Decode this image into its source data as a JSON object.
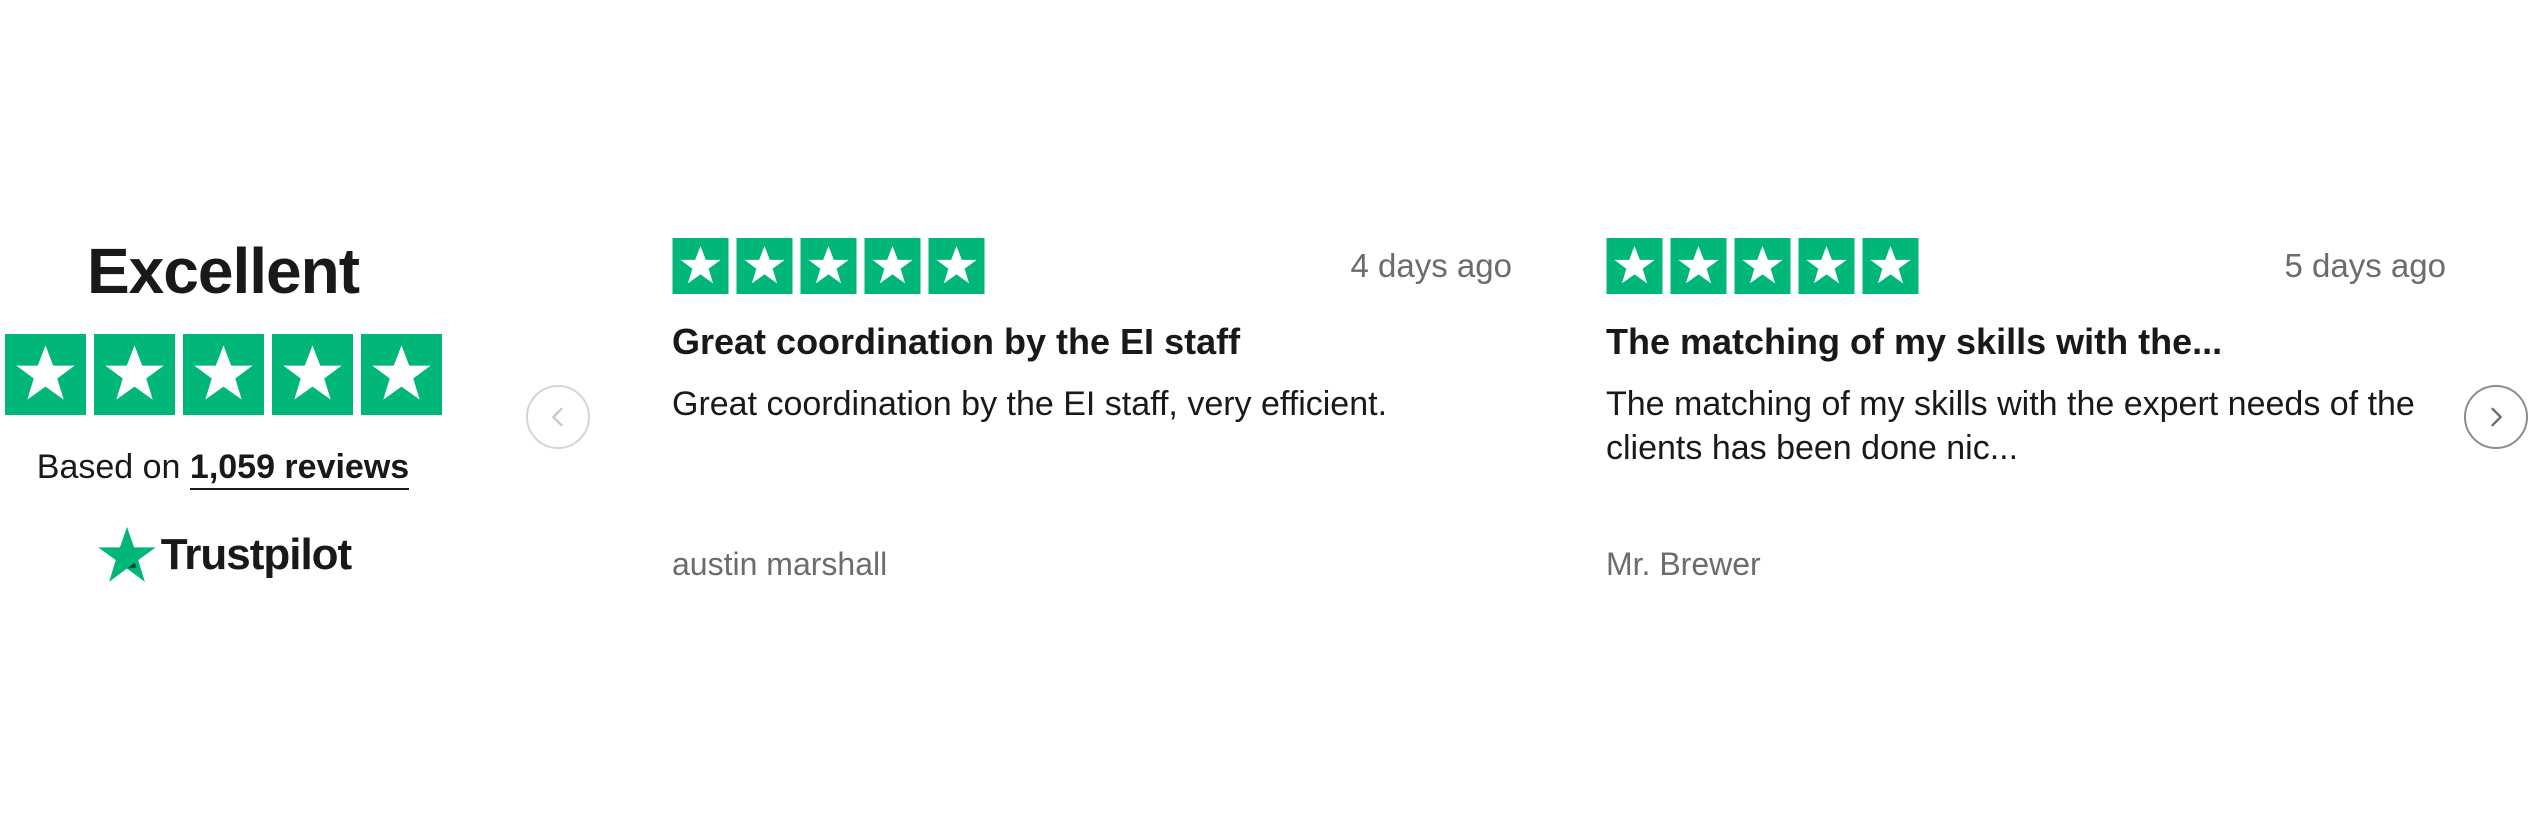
{
  "colors": {
    "star_green": "#00b67a",
    "text_dark": "#191919",
    "text_muted": "#6c6c6c"
  },
  "summary": {
    "rating_label": "Excellent",
    "stars": 5,
    "based_on_prefix": "Based on",
    "review_count_link": "1,059 reviews",
    "brand_name": "Trustpilot",
    "brand_icon": "trustpilot-star-icon"
  },
  "nav": {
    "prev_icon": "chevron-left-icon",
    "next_icon": "chevron-right-icon"
  },
  "reviews": [
    {
      "stars": 5,
      "date": "4 days ago",
      "title": "Great coordination by the EI staff",
      "body": "Great coordination by the EI staff, very efficient.",
      "author": "austin marshall"
    },
    {
      "stars": 5,
      "date": "5 days ago",
      "title": "The matching of my skills with the...",
      "body": "The matching of my skills with the expert needs of the clients has been done nic...",
      "author": "Mr. Brewer"
    }
  ]
}
